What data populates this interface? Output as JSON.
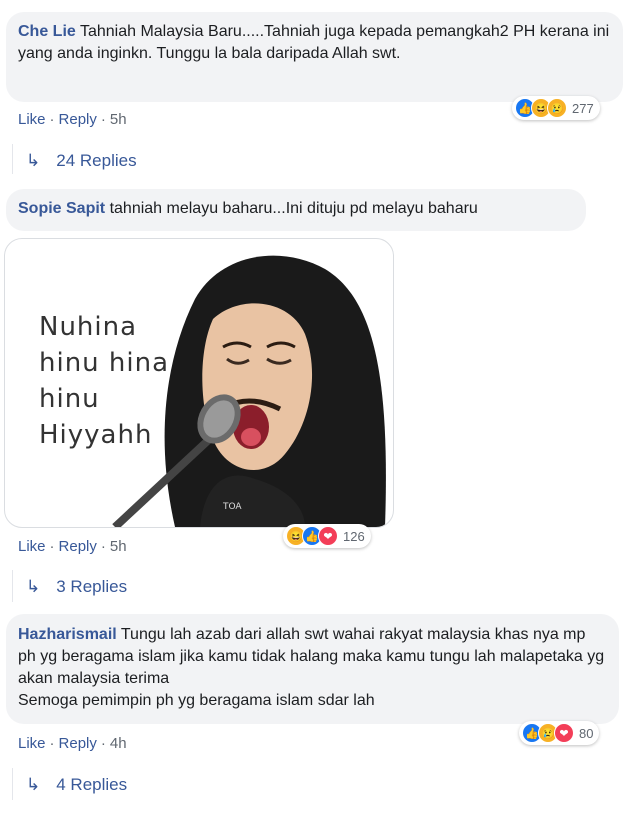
{
  "comments": [
    {
      "author": "Che Lie",
      "text": "Tahniah Malaysia Baru.....Tahniah juga kepada pemangkah2 PH kerana ini yang anda inginkn. Tunggu la bala daripada Allah swt.",
      "reaction_count": "277",
      "reactions": [
        "like",
        "haha",
        "sad"
      ],
      "like_label": "Like",
      "reply_label": "Reply",
      "time": "5h",
      "replies_label": "24 Replies"
    },
    {
      "author": "Sopie Sapit",
      "text": "tahniah melayu baharu...Ini dituju pd melayu baharu",
      "meme_text": [
        "Nuhina",
        "hinu hina",
        "hinu",
        "Hiyyahh"
      ],
      "meme_badge": "TOA",
      "reaction_count": "126",
      "reactions": [
        "haha",
        "like",
        "love"
      ],
      "like_label": "Like",
      "reply_label": "Reply",
      "time": "5h",
      "replies_label": "3 Replies"
    },
    {
      "author": "Hazharismail",
      "text": "Tungu lah azab dari allah swt wahai rakyat malaysia khas nya mp ph yg beragama islam jika kamu tidak halang maka kamu tungu lah malapetaka yg akan malaysia terima",
      "text2": "Semoga pemimpin ph yg beragama islam sdar lah",
      "reaction_count": "80",
      "reactions": [
        "like",
        "sad",
        "love"
      ],
      "like_label": "Like",
      "reply_label": "Reply",
      "time": "4h",
      "replies_label": "4 Replies"
    }
  ],
  "colors": {
    "link": "#385898",
    "bubble": "#f2f3f5",
    "meta": "#606770"
  }
}
